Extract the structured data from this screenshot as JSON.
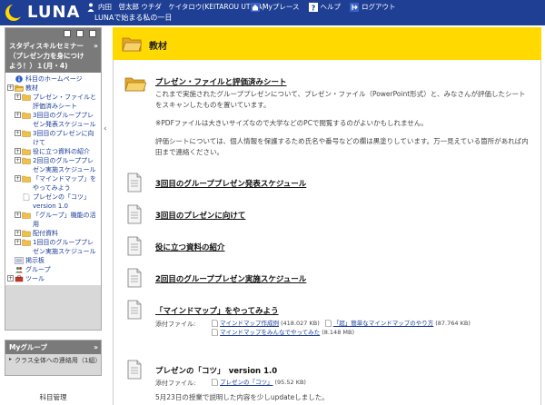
{
  "header": {
    "logo_text": "LUNA",
    "tagline": "LUNAで始まる私の一日",
    "user_name": "内田　啓太郎 ウチダ　ケイタロウ(KEITAROU UTIDA)",
    "links": [
      {
        "label": "Myプレース",
        "icon": "home-icon"
      },
      {
        "label": "ヘルプ",
        "icon": "help-icon"
      },
      {
        "label": "ログアウト",
        "icon": "logout-icon"
      }
    ],
    "colors": {
      "header_bg": "#1f3f94",
      "title_bar": "#ffd900",
      "sidebar_head": "#7a7a7a"
    }
  },
  "sidebar": {
    "course_title": "スタディスキルセミナー（プレゼン力を身につけよう！）１(月・4)",
    "course_close": "»",
    "tree": [
      {
        "label": "科目のホームページ",
        "icon": "info-icon",
        "indent": 0,
        "plus": false
      },
      {
        "label": "教材",
        "icon": "folder-open-icon",
        "indent": 0,
        "plus": true
      },
      {
        "label": "プレゼン・ファイルと評価済みシート",
        "icon": "folder-icon",
        "indent": 1,
        "plus": true
      },
      {
        "label": "3回目のグループプレゼン発表スケジュール",
        "icon": "folder-icon",
        "indent": 1,
        "plus": true
      },
      {
        "label": "3回目のプレゼンに向けて",
        "icon": "folder-icon",
        "indent": 1,
        "plus": true
      },
      {
        "label": "役に立つ資料の紹介",
        "icon": "folder-icon",
        "indent": 1,
        "plus": true
      },
      {
        "label": "2回目のグループプレゼン実施スケジュール",
        "icon": "folder-icon",
        "indent": 1,
        "plus": true
      },
      {
        "label": "「マインドマップ」をやってみよう",
        "icon": "folder-icon",
        "indent": 1,
        "plus": true
      },
      {
        "label": "プレゼンの「コツ」 version 1.0",
        "icon": "document-icon",
        "indent": 1,
        "plus": false
      },
      {
        "label": "「グループ」機能の活用",
        "icon": "folder-icon",
        "indent": 1,
        "plus": true
      },
      {
        "label": "配付資料",
        "icon": "folder-icon",
        "indent": 1,
        "plus": true
      },
      {
        "label": "1回目のグループプレゼン実施スケジュール",
        "icon": "folder-icon",
        "indent": 1,
        "plus": true
      },
      {
        "label": "掲示板",
        "icon": "board-icon",
        "indent": 0,
        "plus": false
      },
      {
        "label": "グループ",
        "icon": "group-icon",
        "indent": 0,
        "plus": false
      },
      {
        "label": "ツール",
        "icon": "tool-icon",
        "indent": 0,
        "plus": true
      }
    ],
    "my_group_title": "Myグループ",
    "my_group_close": "»",
    "my_group_items": [
      {
        "label": "クラス全体への連絡用（1組）"
      }
    ],
    "bottom_label": "科目管理"
  },
  "main": {
    "title": "教材",
    "entries": [
      {
        "title": "プレゼン・ファイルと評価済みシート",
        "type": "folder",
        "desc": [
          "これまで実施されたグループプレゼンについて、プレゼン・ファイル（PowerPoint形式）と、みなさんが評価したシートをスキャンしたものを置いています。",
          "※PDFファイルは大きいサイズなので大学などのPCで閲覧するのがよいかもしれません。",
          "評価シートについては、個人情報を保護するため氏名や番号などの欄は黒塗りしています。万一見えている箇所があれば内田まで連絡ください。"
        ]
      },
      {
        "title": "3回目のグループプレゼン発表スケジュール",
        "type": "document"
      },
      {
        "title": "3回目のプレゼンに向けて",
        "type": "document"
      },
      {
        "title": "役に立つ資料の紹介",
        "type": "document"
      },
      {
        "title": "2回目のグループプレゼン実施スケジュール",
        "type": "document"
      },
      {
        "title": "「マインドマップ」をやってみよう",
        "type": "document",
        "attach_label": "添付ファイル:",
        "attachments": [
          {
            "name": "マインドマップ作成例",
            "size": "(418.027 KB)"
          },
          {
            "name": "「超」簡単なマインドマップのやり方",
            "size": "(87.764 KB)"
          },
          {
            "name": "マインドマップをみんなでやってみた",
            "size": "(8.148 MB)"
          }
        ]
      },
      {
        "title": "プレゼンの「コツ」　version 1.0",
        "type": "document",
        "attach_label": "添付ファイル:",
        "attachments": [
          {
            "name": "プレゼンの「コツ」",
            "size": "(95.52 KB)"
          }
        ],
        "desc": [
          "5月23日の授業で説明した内容を少しupdateしました。"
        ]
      }
    ]
  }
}
